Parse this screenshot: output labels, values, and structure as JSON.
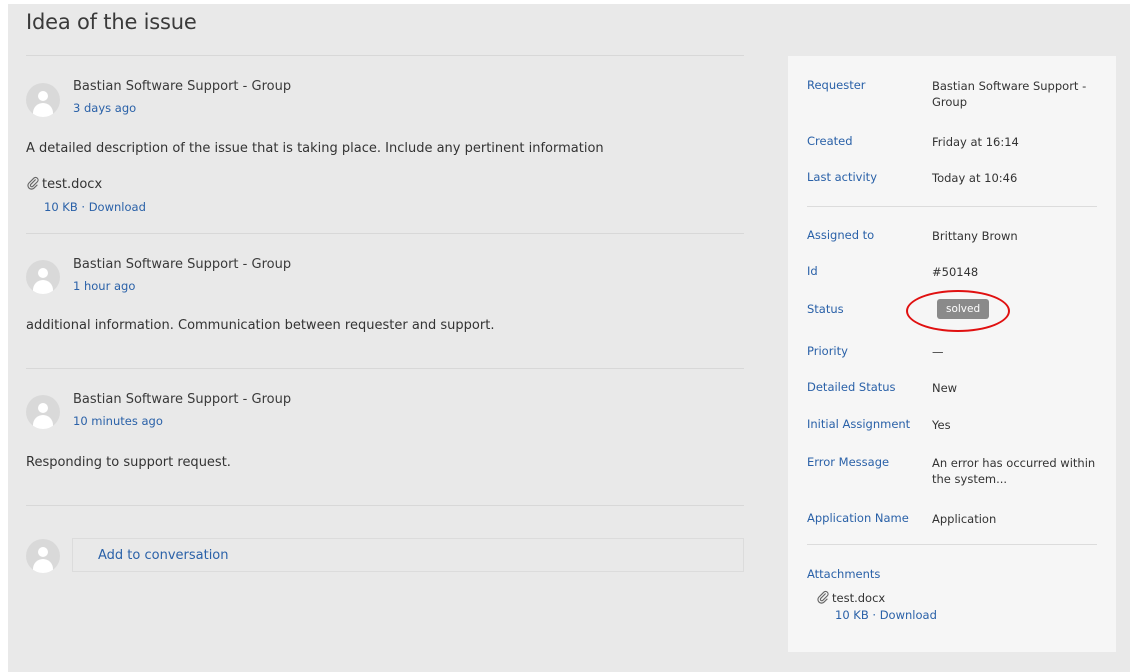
{
  "page": {
    "title": "Idea of the issue"
  },
  "comments": [
    {
      "author": "Bastian Software Support - Group",
      "time": "3 days ago",
      "body": "A detailed description of the issue that is taking place. Include any pertinent information",
      "attachment": {
        "name": "test.docx",
        "size": "10 KB",
        "separator": "·",
        "download": "Download"
      }
    },
    {
      "author": "Bastian Software Support - Group",
      "time": "1 hour ago",
      "body": "additional information. Communication between requester and support."
    },
    {
      "author": "Bastian Software Support - Group",
      "time": "10 minutes ago",
      "body": "Responding to support request."
    }
  ],
  "reply": {
    "placeholder": "Add to conversation"
  },
  "details": {
    "requester": {
      "label": "Requester",
      "value": "Bastian Software Support - Group"
    },
    "created": {
      "label": "Created",
      "value": "Friday at 16:14"
    },
    "last_activity": {
      "label": "Last activity",
      "value": "Today at 10:46"
    },
    "assigned_to": {
      "label": "Assigned to",
      "value": "Brittany Brown"
    },
    "id": {
      "label": "Id",
      "value": "#50148"
    },
    "status": {
      "label": "Status",
      "value": "solved"
    },
    "priority": {
      "label": "Priority",
      "value": "—"
    },
    "detailed_status": {
      "label": "Detailed Status",
      "value": "New"
    },
    "initial_assignment": {
      "label": "Initial Assignment",
      "value": "Yes"
    },
    "error_message": {
      "label": "Error Message",
      "value": "An error has occurred within the system..."
    },
    "application_name": {
      "label": "Application Name",
      "value": "Application"
    },
    "attachments": {
      "label": "Attachments",
      "file": {
        "name": "test.docx",
        "size": "10 KB",
        "separator": "·",
        "download": "Download"
      }
    }
  },
  "colors": {
    "link": "#2a61a8",
    "badge": "#8a8a8a",
    "highlight": "#e01010",
    "page_bg": "#e9e9e9",
    "sidebar_bg": "#f6f6f6"
  },
  "icons": {
    "avatar": "user-avatar-icon",
    "attachment": "paperclip-icon"
  }
}
